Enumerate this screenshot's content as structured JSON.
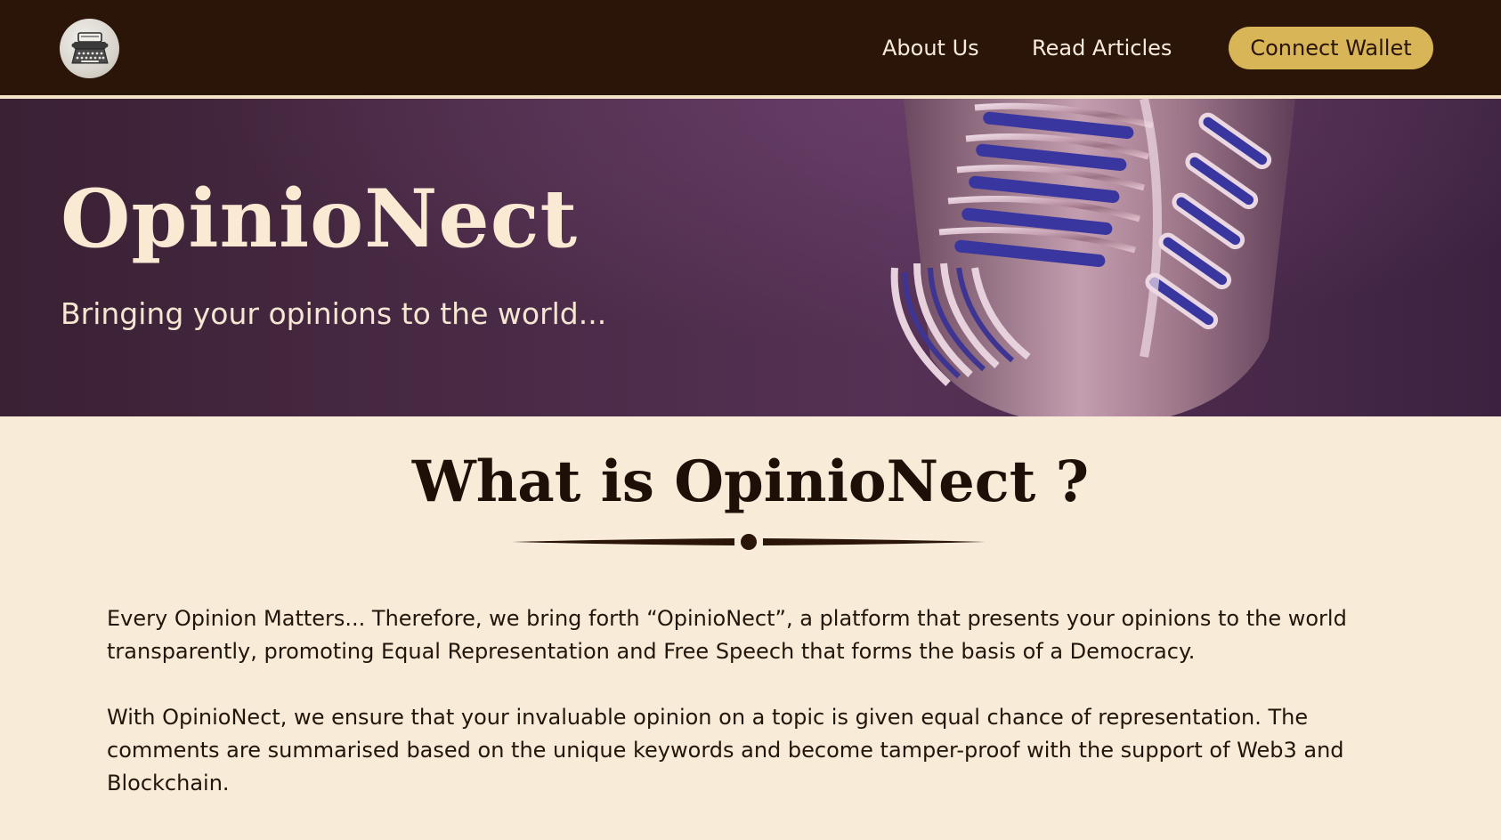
{
  "nav": {
    "logo_icon": "typewriter-icon",
    "links": [
      "About Us",
      "Read Articles"
    ],
    "cta_label": "Connect Wallet"
  },
  "hero": {
    "title": "OpinioNect",
    "subtitle": "Bringing your opinions to the world...",
    "image": "microphone-image"
  },
  "about": {
    "title": "What is OpinioNect ?",
    "paragraphs": [
      "Every Opinion Matters... Therefore, we bring forth “OpinioNect”, a platform that presents your opinions to the world transparently, promoting Equal Representation and Free Speech that forms the basis of a Democracy.",
      "With OpinioNect, we ensure that your invaluable opinion on a topic is given equal chance of representation. The comments are summarised based on the unique keywords and become tamper-proof with the support of Web3 and Blockchain."
    ]
  },
  "colors": {
    "nav_bg": "#2a1508",
    "accent": "#d8b657",
    "page_bg": "#f8ecd9",
    "hero_bg": "#4a2b47"
  }
}
